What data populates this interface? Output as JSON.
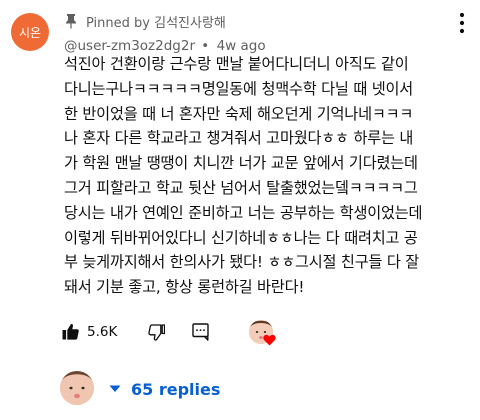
{
  "comment": {
    "avatar_text": "시온",
    "pinned_label": "Pinned by 김석진사랑해",
    "author": "@user-zm3oz2dg2r",
    "separator": "•",
    "time": "4w ago",
    "body": "석진아 건환이랑 근수랑 맨날 붙어다니더니 아직도 같이\n다니는구나ㅋㅋㅋㅋㅋ명일동에 청맥수학 다닐 때 넷이서\n한 반이었을 때 너 혼자만 숙제 해오던게 기억나네ㅋㅋㅋ\n나 혼자 다른 학교라고 챙겨줘서 고마웠다ㅎㅎ 하루는 내\n가 학원 맨날 땡땡이 치니깐 너가 교문 앞에서 기다렸는데\n그거 피할라고 학교 뒷산 넘어서 탈출했었는뎈ㅋㅋㅋㅋ그\n당시는 내가 연예인 준비하고 너는 공부하는 학생이었는데\n이렇게 뒤바뀌어있다니 신기하네ㅎㅎ나는 다 때려치고 공\n부 늦게까지해서 한의사가 됐다! ㅎㅎ그시절 친구들 다 잘\n돼서 기분 좋고, 항상 롱런하길 바란다!"
  },
  "actions": {
    "like_count": "5.6K"
  },
  "replies": {
    "label": "65 replies"
  },
  "colors": {
    "avatar_bg": "#ef6a34",
    "link_blue": "#065fd4",
    "meta_gray": "#606060",
    "heart_red": "#ff0000"
  },
  "icons": {
    "pin": "pin-icon",
    "more": "more-vertical-icon",
    "like": "thumbs-up-icon",
    "dislike": "thumbs-down-icon",
    "reply": "reply-comment-icon",
    "heart": "creator-heart-icon",
    "caret": "chevron-down-icon"
  }
}
